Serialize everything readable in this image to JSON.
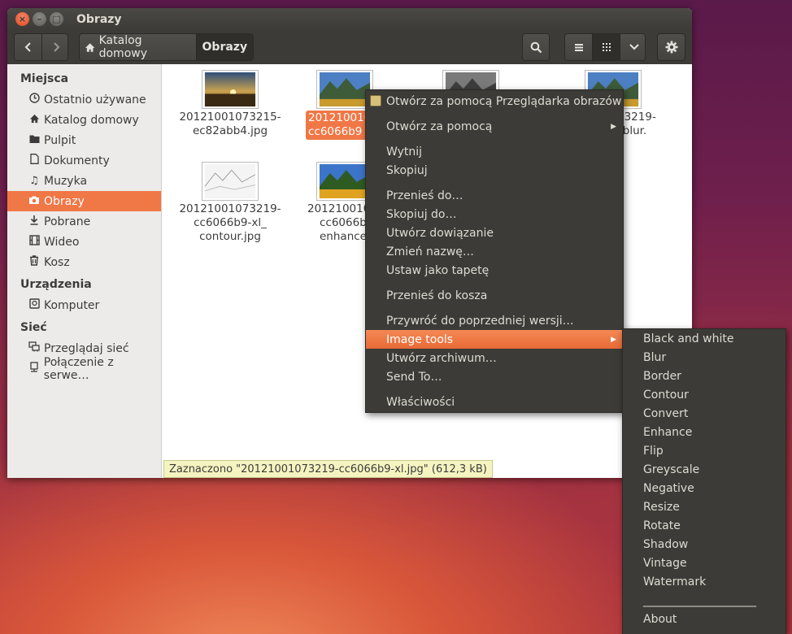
{
  "window": {
    "title": "Obrazy",
    "buttons": {
      "close": "×",
      "minimize": "–",
      "maximize": "□"
    }
  },
  "toolbar": {
    "back_icon": "chevron-left-icon",
    "forward_icon": "chevron-right-icon",
    "breadcrumb": [
      {
        "label": "Katalog domowy",
        "icon": "home-icon"
      },
      {
        "label": "Obrazy"
      }
    ],
    "search_icon": "search-icon",
    "list_view_icon": "list-icon",
    "grid_view_icon": "grid-icon",
    "view_menu_icon": "chevron-down-icon",
    "settings_icon": "gear-icon"
  },
  "sidebar": {
    "sections": [
      {
        "title": "Miejsca",
        "items": [
          {
            "label": "Ostatnio używane",
            "icon": "clock-icon"
          },
          {
            "label": "Katalog domowy",
            "icon": "home-icon"
          },
          {
            "label": "Pulpit",
            "icon": "folder-icon"
          },
          {
            "label": "Dokumenty",
            "icon": "document-icon"
          },
          {
            "label": "Muzyka",
            "icon": "music-icon"
          },
          {
            "label": "Obrazy",
            "icon": "camera-icon",
            "active": true
          },
          {
            "label": "Pobrane",
            "icon": "download-icon"
          },
          {
            "label": "Wideo",
            "icon": "film-icon"
          },
          {
            "label": "Kosz",
            "icon": "trash-icon"
          }
        ]
      },
      {
        "title": "Urządzenia",
        "items": [
          {
            "label": "Komputer",
            "icon": "computer-icon"
          }
        ]
      },
      {
        "title": "Sieć",
        "items": [
          {
            "label": "Przeglądaj sieć",
            "icon": "network-icon"
          },
          {
            "label": "Połączenie z serwe…",
            "icon": "server-icon"
          }
        ]
      }
    ]
  },
  "files": [
    {
      "line1": "20121001073215-",
      "line2": "ec82abb4.jpg",
      "thumb": "sunset"
    },
    {
      "line1": "2012100107",
      "line2": "cc6066b9",
      "thumb": "mountain",
      "selected": true
    },
    {
      "line1": "",
      "line2": "",
      "thumb": "mountain-bw"
    },
    {
      "line1": "73219-",
      "line2": "_blur.",
      "thumb": "mountain"
    },
    {
      "line1": "20121001073219-",
      "line2": "cc6066b9-xl_",
      "line3": "contour.jpg",
      "thumb": "contour"
    },
    {
      "line1": "2012100107",
      "line2": "cc6066b",
      "line3": "enhance",
      "thumb": "mountain-enhanced"
    }
  ],
  "status": {
    "text": "Zaznaczono \"20121001073219-cc6066b9-xl.jpg\"  (612,3 kB)"
  },
  "context_menu": {
    "groups": [
      [
        {
          "label": "Otwórz za pomocą Przeglądarka obrazów",
          "icon": "image-viewer-icon"
        },
        {
          "label": "Otwórz za pomocą",
          "submenu": true
        }
      ],
      [
        {
          "label": "Wytnij"
        },
        {
          "label": "Skopiuj"
        }
      ],
      [
        {
          "label": "Przenieś do…"
        },
        {
          "label": "Skopiuj do…"
        },
        {
          "label": "Utwórz dowiązanie"
        },
        {
          "label": "Zmień nazwę…"
        },
        {
          "label": "Ustaw jako tapetę"
        }
      ],
      [
        {
          "label": "Przenieś do kosza"
        }
      ],
      [
        {
          "label": "Przywróć do poprzedniej wersji…"
        },
        {
          "label": "Image tools",
          "submenu": true,
          "highlighted": true
        },
        {
          "label": "Utwórz archiwum…"
        },
        {
          "label": "Send To…"
        }
      ],
      [
        {
          "label": "Właściwości"
        }
      ]
    ]
  },
  "image_tools_menu": {
    "items": [
      "Black and white",
      "Blur",
      "Border",
      "Contour",
      "Convert",
      "Enhance",
      "Flip",
      "Greyscale",
      "Negative",
      "Resize",
      "Rotate",
      "Shadow",
      "Vintage",
      "Watermark"
    ],
    "separator": "_______________________",
    "about": "About"
  },
  "colors": {
    "accent": "#f07746",
    "menu_bg": "#3c3b37",
    "statusbar_bg": "#f5f4c0"
  }
}
